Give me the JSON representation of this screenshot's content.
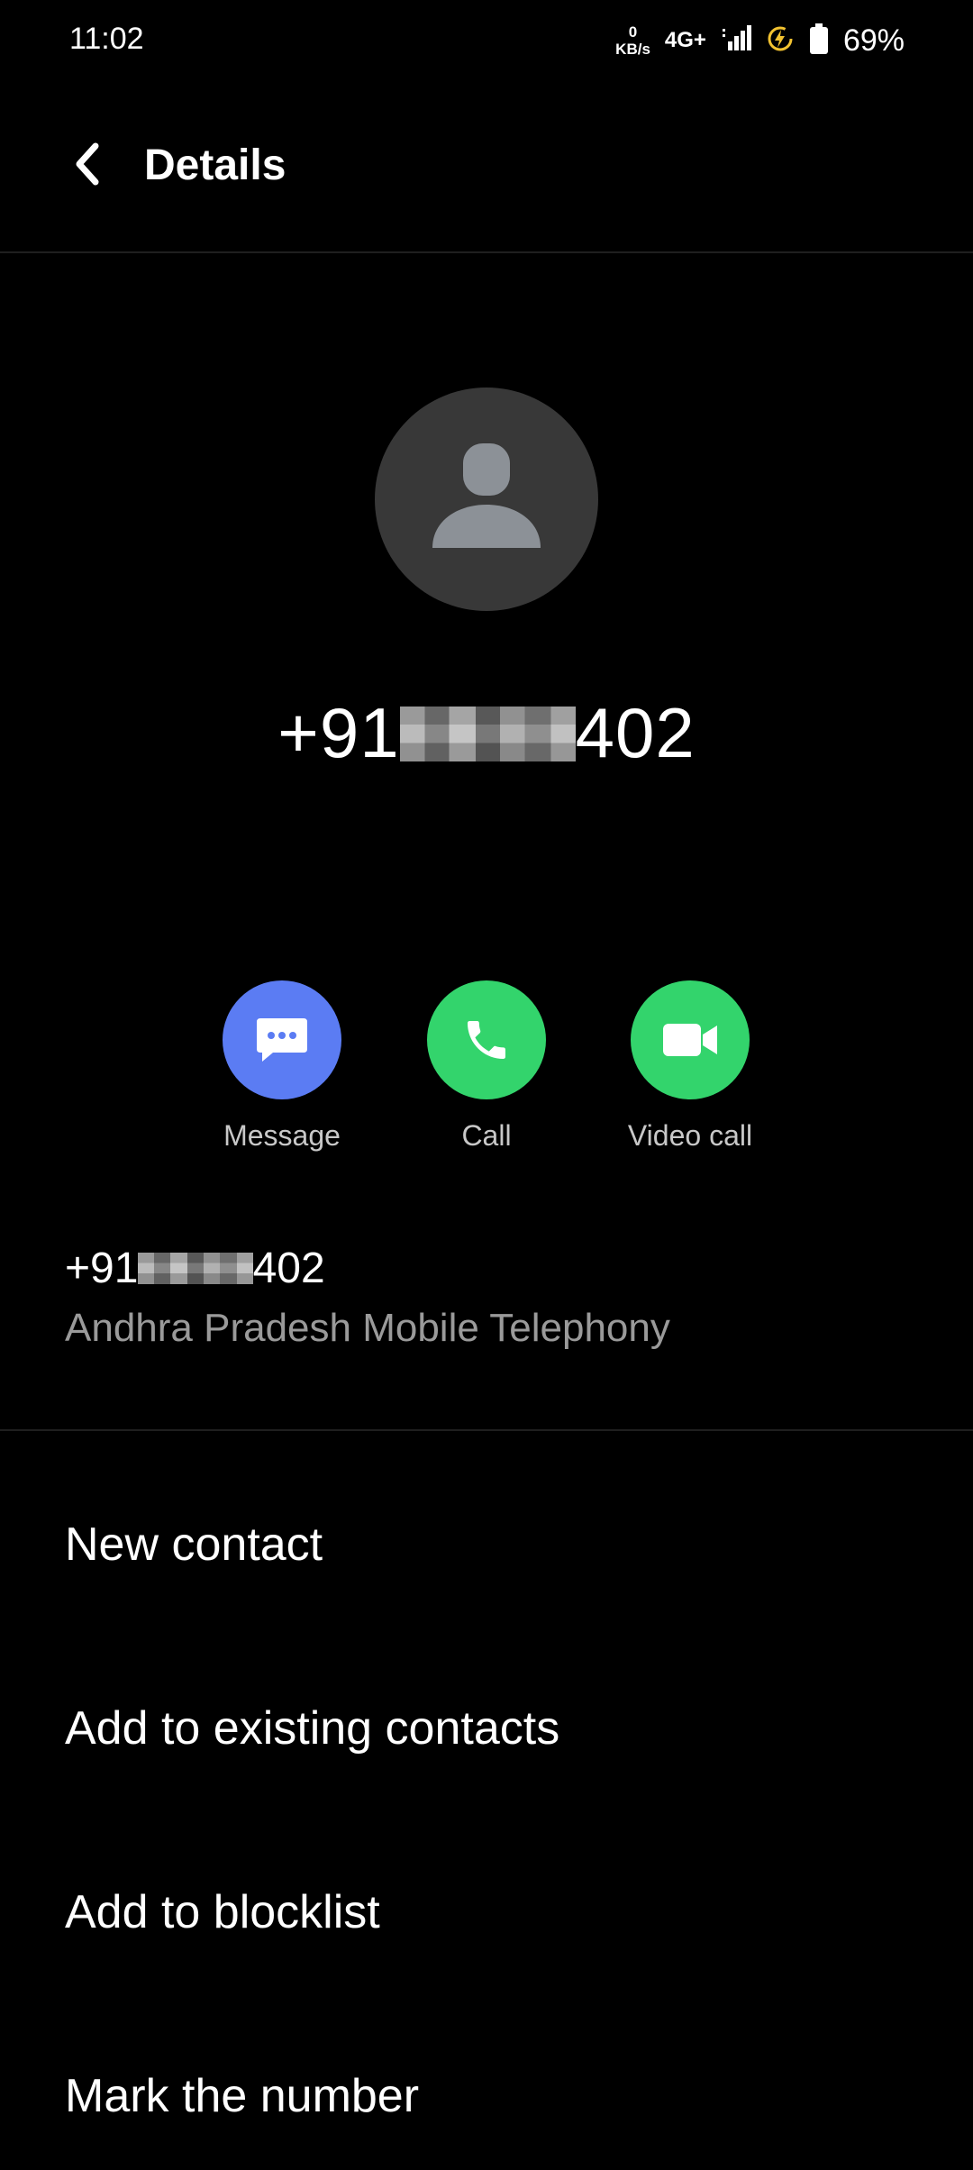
{
  "status_bar": {
    "time": "11:02",
    "net_speed_value": "0",
    "net_speed_unit": "KB/s",
    "network_type": "4G+",
    "battery": "69%"
  },
  "header": {
    "title": "Details"
  },
  "contact": {
    "number_prefix": "+91",
    "number_suffix": "402",
    "carrier": "Andhra Pradesh Mobile Telephony"
  },
  "actions": [
    {
      "label": "Message",
      "color": "#5b7cf3",
      "icon": "message-icon"
    },
    {
      "label": "Call",
      "color": "#33d46c",
      "icon": "phone-icon"
    },
    {
      "label": "Video call",
      "color": "#33d46c",
      "icon": "video-icon"
    }
  ],
  "options": {
    "new_contact": "New contact",
    "add_existing": "Add to existing contacts",
    "add_blocklist": "Add to blocklist",
    "mark_number": "Mark the number"
  }
}
